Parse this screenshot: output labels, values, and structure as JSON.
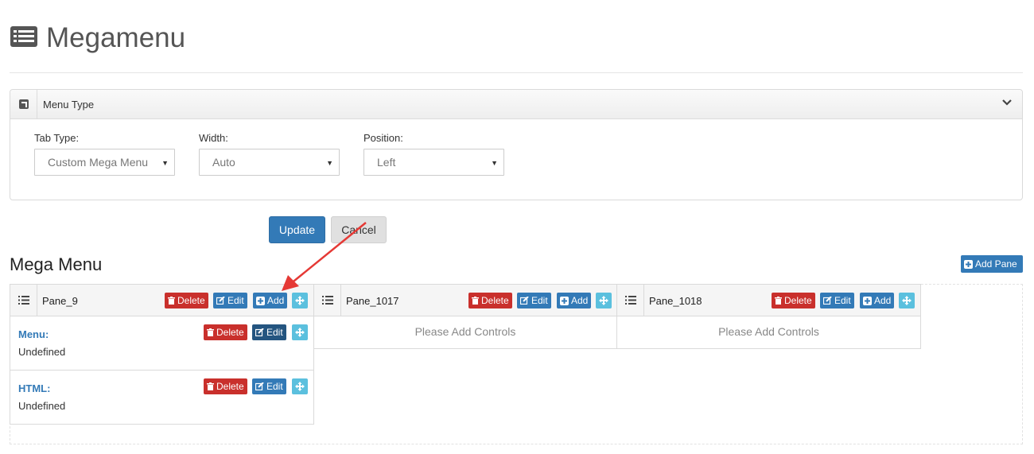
{
  "page": {
    "title": "Megamenu",
    "icon": "list-alt-icon"
  },
  "menu_type_panel": {
    "title": "Menu Type",
    "fields": {
      "tab_type": {
        "label": "Tab Type:",
        "value": "Custom Mega Menu"
      },
      "width": {
        "label": "Width:",
        "value": "Auto"
      },
      "position": {
        "label": "Position:",
        "value": "Left"
      }
    }
  },
  "actions": {
    "update": "Update",
    "cancel": "Cancel"
  },
  "mega_menu": {
    "title": "Mega Menu",
    "add_pane": "Add Pane",
    "panes": [
      {
        "name": "Pane_9",
        "buttons": {
          "delete": "Delete",
          "edit": "Edit",
          "add": "Add"
        },
        "controls": [
          {
            "label": "Menu:",
            "value": "Undefined",
            "delete": "Delete",
            "edit": "Edit"
          },
          {
            "label": "HTML:",
            "value": "Undefined",
            "delete": "Delete",
            "edit": "Edit"
          }
        ]
      },
      {
        "name": "Pane_1017",
        "buttons": {
          "delete": "Delete",
          "edit": "Edit",
          "add": "Add"
        },
        "empty_text": "Please Add Controls"
      },
      {
        "name": "Pane_1018",
        "buttons": {
          "delete": "Delete",
          "edit": "Edit",
          "add": "Add"
        },
        "empty_text": "Please Add Controls"
      }
    ]
  },
  "colors": {
    "primary": "#337ab7",
    "danger": "#c9302c",
    "info": "#5bc0de",
    "annotation_arrow": "#e53935"
  }
}
